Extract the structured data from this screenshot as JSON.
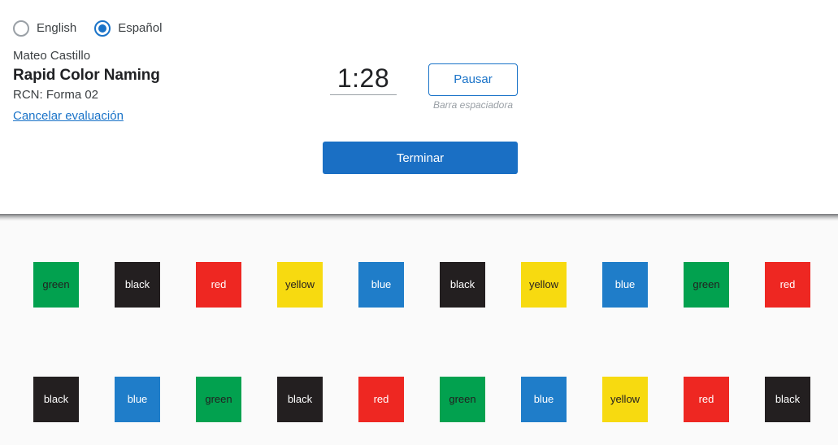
{
  "header": {
    "language_options": [
      {
        "label": "English",
        "selected": false
      },
      {
        "label": "Español",
        "selected": true
      }
    ],
    "student_name": "Mateo Castillo",
    "assessment_title": "Rapid Color Naming",
    "form_label": "RCN: Forma 02",
    "cancel_link": "Cancelar evaluación",
    "timer": "1:28",
    "pause_button": "Pausar",
    "pause_hint": "Barra espaciadora",
    "finish_button": "Terminar"
  },
  "colors": {
    "accent_blue": "#1a73c8",
    "finish_blue": "#1a6fc4",
    "tile_green": "#02a14f",
    "tile_black": "#231f20",
    "tile_red": "#ee2722",
    "tile_yellow": "#f7da10",
    "tile_blue": "#1f7dc9",
    "header_bg": "#ffffff",
    "stimulus_bg": "#fafafa"
  },
  "stimulus": {
    "rows": [
      [
        {
          "label": "green",
          "bg": "#02a14f",
          "fg": "#231f20"
        },
        {
          "label": "black",
          "bg": "#231f20",
          "fg": "#ffffff"
        },
        {
          "label": "red",
          "bg": "#ee2722",
          "fg": "#ffffff"
        },
        {
          "label": "yellow",
          "bg": "#f7da10",
          "fg": "#231f20"
        },
        {
          "label": "blue",
          "bg": "#1f7dc9",
          "fg": "#ffffff"
        },
        {
          "label": "black",
          "bg": "#231f20",
          "fg": "#ffffff"
        },
        {
          "label": "yellow",
          "bg": "#f7da10",
          "fg": "#231f20"
        },
        {
          "label": "blue",
          "bg": "#1f7dc9",
          "fg": "#ffffff"
        },
        {
          "label": "green",
          "bg": "#02a14f",
          "fg": "#231f20"
        },
        {
          "label": "red",
          "bg": "#ee2722",
          "fg": "#ffffff"
        }
      ],
      [
        {
          "label": "black",
          "bg": "#231f20",
          "fg": "#ffffff"
        },
        {
          "label": "blue",
          "bg": "#1f7dc9",
          "fg": "#ffffff"
        },
        {
          "label": "green",
          "bg": "#02a14f",
          "fg": "#231f20"
        },
        {
          "label": "black",
          "bg": "#231f20",
          "fg": "#ffffff"
        },
        {
          "label": "red",
          "bg": "#ee2722",
          "fg": "#ffffff"
        },
        {
          "label": "green",
          "bg": "#02a14f",
          "fg": "#231f20"
        },
        {
          "label": "blue",
          "bg": "#1f7dc9",
          "fg": "#ffffff"
        },
        {
          "label": "yellow",
          "bg": "#f7da10",
          "fg": "#231f20"
        },
        {
          "label": "red",
          "bg": "#ee2722",
          "fg": "#ffffff"
        },
        {
          "label": "black",
          "bg": "#231f20",
          "fg": "#ffffff"
        }
      ]
    ]
  }
}
